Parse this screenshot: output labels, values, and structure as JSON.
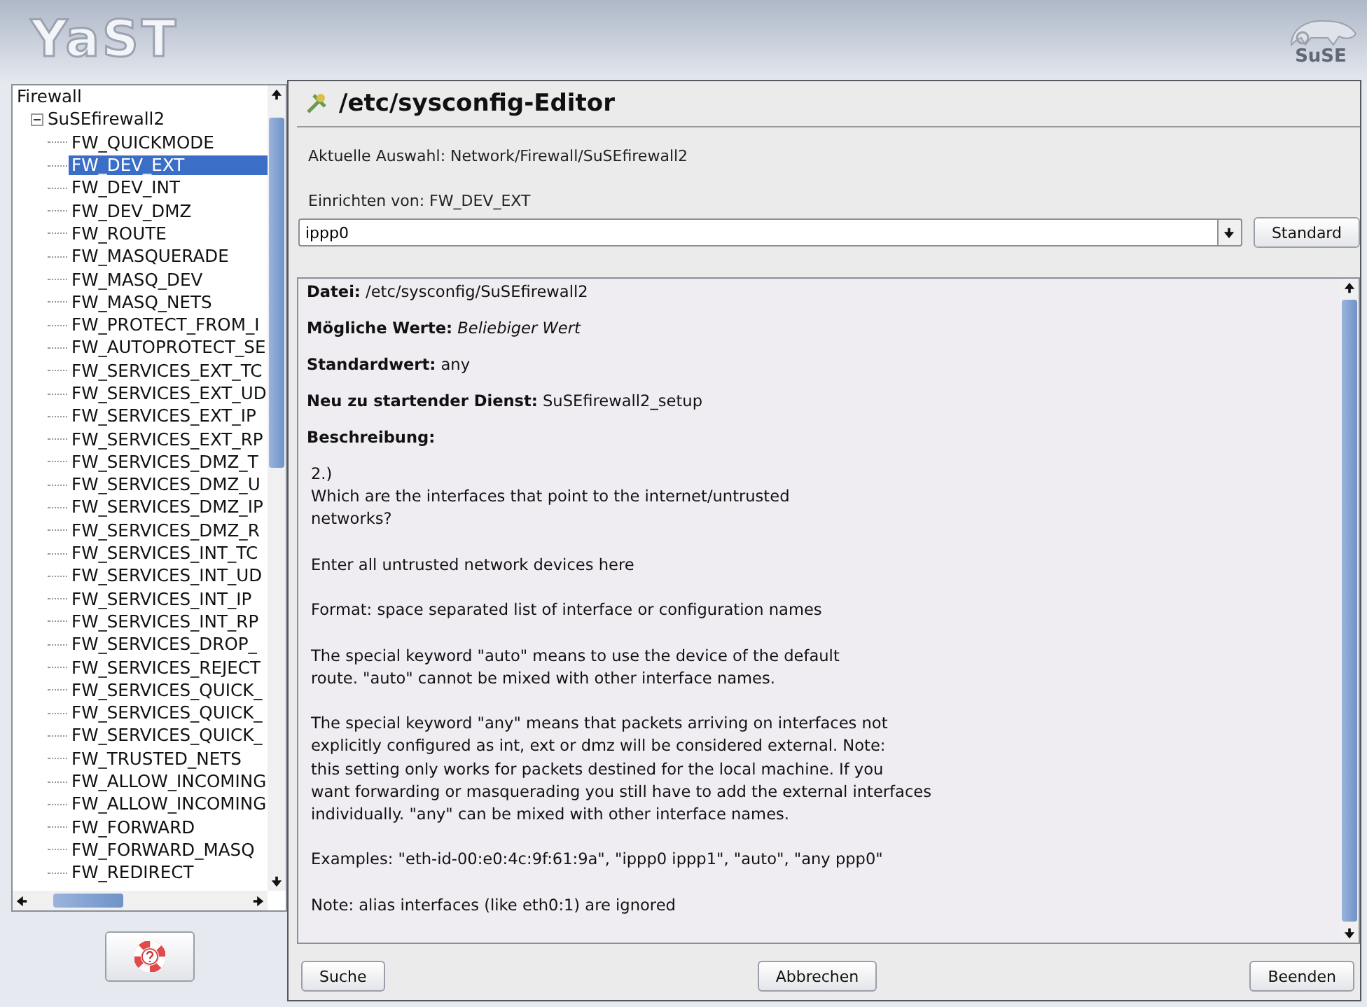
{
  "header": {
    "logo": "YaST",
    "brand": "SuSE"
  },
  "tree": [
    {
      "label": "Firewall",
      "children": [
        {
          "label": "SuSEfirewall2",
          "expanded": true,
          "children": [
            {
              "label": "FW_QUICKMODE",
              "selected": false
            },
            {
              "label": "FW_DEV_EXT",
              "selected": true
            },
            {
              "label": "FW_DEV_INT",
              "selected": false
            },
            {
              "label": "FW_DEV_DMZ",
              "selected": false
            },
            {
              "label": "FW_ROUTE",
              "selected": false
            },
            {
              "label": "FW_MASQUERADE",
              "selected": false
            },
            {
              "label": "FW_MASQ_DEV",
              "selected": false
            },
            {
              "label": "FW_MASQ_NETS",
              "selected": false
            },
            {
              "label": "FW_PROTECT_FROM_I",
              "selected": false
            },
            {
              "label": "FW_AUTOPROTECT_SE",
              "selected": false
            },
            {
              "label": "FW_SERVICES_EXT_TC",
              "selected": false
            },
            {
              "label": "FW_SERVICES_EXT_UD",
              "selected": false
            },
            {
              "label": "FW_SERVICES_EXT_IP",
              "selected": false
            },
            {
              "label": "FW_SERVICES_EXT_RP",
              "selected": false
            },
            {
              "label": "FW_SERVICES_DMZ_T",
              "selected": false
            },
            {
              "label": "FW_SERVICES_DMZ_U",
              "selected": false
            },
            {
              "label": "FW_SERVICES_DMZ_IP",
              "selected": false
            },
            {
              "label": "FW_SERVICES_DMZ_R",
              "selected": false
            },
            {
              "label": "FW_SERVICES_INT_TC",
              "selected": false
            },
            {
              "label": "FW_SERVICES_INT_UD",
              "selected": false
            },
            {
              "label": "FW_SERVICES_INT_IP",
              "selected": false
            },
            {
              "label": "FW_SERVICES_INT_RP",
              "selected": false
            },
            {
              "label": "FW_SERVICES_DROP_",
              "selected": false
            },
            {
              "label": "FW_SERVICES_REJECT",
              "selected": false
            },
            {
              "label": "FW_SERVICES_QUICK_",
              "selected": false
            },
            {
              "label": "FW_SERVICES_QUICK_",
              "selected": false
            },
            {
              "label": "FW_SERVICES_QUICK_",
              "selected": false
            },
            {
              "label": "FW_TRUSTED_NETS",
              "selected": false
            },
            {
              "label": "FW_ALLOW_INCOMING",
              "selected": false
            },
            {
              "label": "FW_ALLOW_INCOMING",
              "selected": false
            },
            {
              "label": "FW_FORWARD",
              "selected": false
            },
            {
              "label": "FW_FORWARD_MASQ",
              "selected": false
            },
            {
              "label": "FW_REDIRECT",
              "selected": false
            }
          ]
        }
      ]
    }
  ],
  "editor": {
    "title": "/etc/sysconfig-Editor",
    "current": "Aktuelle Auswahl: Network/Firewall/SuSEfirewall2",
    "setup_label": "Einrichten von: FW_DEV_EXT",
    "value": "ippp0",
    "default_button": "Standard",
    "info": [
      "**Datei:** /etc/sysconfig/SuSEfirewall2",
      "**Mögliche Werte:** *Beliebiger Wert*",
      "**Standardwert:** any",
      "**Neu zu startender Dienst:** SuSEfirewall2_setup",
      "**Beschreibung:**"
    ],
    "description": [
      "2.)\nWhich are the interfaces that point to the internet/untrusted\nnetworks?",
      "Enter all untrusted network devices here",
      "Format: space separated list of interface or configuration names",
      "The special keyword \"auto\" means to use the device of the default\nroute. \"auto\" cannot be mixed with other interface names.",
      "The special keyword \"any\" means that packets arriving on interfaces not\nexplicitly configured as int, ext or dmz will be considered external. Note:\nthis setting only works for packets destined for the local machine. If you\nwant forwarding or masquerading you still have to add the external interfaces\nindividually. \"any\" can be mixed with other interface names.",
      "Examples: \"eth-id-00:e0:4c:9f:61:9a\", \"ippp0 ippp1\", \"auto\", \"any ppp0\"",
      "Note: alias interfaces (like eth0:1) are ignored"
    ]
  },
  "buttons": [
    "Suche",
    "Abbrechen",
    "Beenden"
  ]
}
